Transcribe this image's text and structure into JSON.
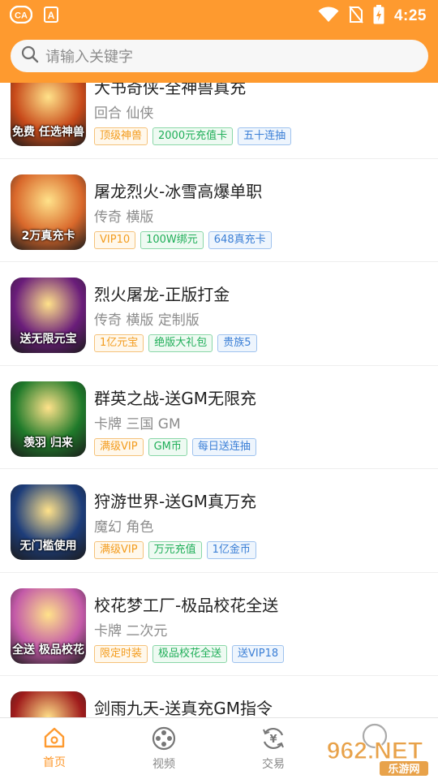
{
  "status": {
    "time": "4:25"
  },
  "search": {
    "placeholder": "请输入关键字"
  },
  "games": [
    {
      "title": "大书奇侠-全神兽真充",
      "subtitle": "回合 仙侠",
      "thumb_text": "免费 任选神兽",
      "tags": [
        {
          "text": "顶级神兽",
          "color": "orange"
        },
        {
          "text": "2000元充值卡",
          "color": "green"
        },
        {
          "text": "五十连抽",
          "color": "blue"
        }
      ]
    },
    {
      "title": "屠龙烈火-冰雪高爆单职",
      "subtitle": "传奇 横版",
      "thumb_text": "2万真充卡",
      "tags": [
        {
          "text": "VIP10",
          "color": "orange"
        },
        {
          "text": "100W绑元",
          "color": "green"
        },
        {
          "text": "648真充卡",
          "color": "blue"
        }
      ]
    },
    {
      "title": "烈火屠龙-正版打金",
      "subtitle": "传奇 横版 定制版",
      "thumb_text": "送无限元宝",
      "tags": [
        {
          "text": "1亿元宝",
          "color": "orange"
        },
        {
          "text": "绝版大礼包",
          "color": "green"
        },
        {
          "text": "贵族5",
          "color": "blue"
        }
      ]
    },
    {
      "title": "群英之战-送GM无限充",
      "subtitle": "卡牌 三国 GM",
      "thumb_text": "羡羽 归来",
      "tags": [
        {
          "text": "满级VIP",
          "color": "orange"
        },
        {
          "text": "GM币",
          "color": "green"
        },
        {
          "text": "每日送连抽",
          "color": "blue"
        }
      ]
    },
    {
      "title": "狩游世界-送GM真万充",
      "subtitle": "魔幻 角色",
      "thumb_text": "无门槛使用",
      "tags": [
        {
          "text": "满级VIP",
          "color": "orange"
        },
        {
          "text": "万元充值",
          "color": "green"
        },
        {
          "text": "1亿金币",
          "color": "blue"
        }
      ]
    },
    {
      "title": "校花梦工厂-极品校花全送",
      "subtitle": "卡牌 二次元",
      "thumb_text": "全送 极品校花",
      "tags": [
        {
          "text": "限定时装",
          "color": "orange"
        },
        {
          "text": "极品校花全送",
          "color": "green"
        },
        {
          "text": "送VIP18",
          "color": "blue"
        }
      ]
    },
    {
      "title": "剑雨九天-送真充GM指令",
      "subtitle": "",
      "thumb_text": "",
      "tags": []
    }
  ],
  "thumb_colors": [
    "#c84a1a",
    "#d9682b",
    "#6a1d7a",
    "#1f7a2a",
    "#1d3d7a",
    "#c35aa8",
    "#a01c1c"
  ],
  "nav": {
    "home": "首页",
    "video": "视频",
    "trade": "交易"
  },
  "watermark": {
    "brand": "962.NET",
    "sub": "乐游网"
  },
  "colors": {
    "accent": "#fe9a2f"
  }
}
